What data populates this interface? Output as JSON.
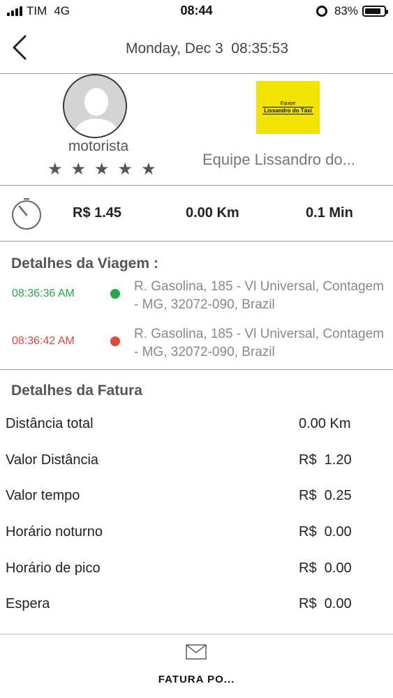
{
  "status_bar": {
    "carrier": "TIM",
    "network": "4G",
    "time": "08:44",
    "battery_percent": "83%",
    "battery_level": 0.83,
    "icons": [
      "signal-icon",
      "alarm-icon",
      "battery-icon"
    ]
  },
  "header": {
    "back_icon": "chevron-left-icon",
    "title": "Monday, Dec 3  08:35:53"
  },
  "driver": {
    "name": "motorista",
    "rating": 5,
    "star_glyph": "★",
    "company_name": "Equipe Lissandro do...",
    "logo_top": "Equipe",
    "logo_text": "Lissandro do Táxi"
  },
  "summary": {
    "timer_icon": "stopwatch-icon",
    "fare": "R$  1.45",
    "distance": "0.00 Km",
    "duration": "0.1 Min"
  },
  "trip": {
    "title": "Detalhes da Viagem :",
    "start": {
      "time": "08:36:36 AM",
      "address": "R. Gasolina, 185 - Vl Universal, Contagem - MG, 32072-090, Brazil",
      "color": "#27a745"
    },
    "end": {
      "time": "08:36:42 AM",
      "address": "R. Gasolina, 185 - Vl Universal, Contagem - MG, 32072-090, Brazil",
      "color": "#e0483a"
    }
  },
  "invoice": {
    "title": "Detalhes da Fatura",
    "rows": [
      {
        "label": "Distância total",
        "value": "0.00 Km"
      },
      {
        "label": "Valor Distância",
        "value": "R$  1.20"
      },
      {
        "label": "Valor tempo",
        "value": "R$  0.25"
      },
      {
        "label": "Horário noturno",
        "value": "R$  0.00"
      },
      {
        "label": "Horário de pico",
        "value": "R$  0.00"
      },
      {
        "label": "Espera",
        "value": "R$  0.00"
      }
    ]
  },
  "bottom": {
    "icon": "mail-icon",
    "label": "FATURA PO..."
  }
}
